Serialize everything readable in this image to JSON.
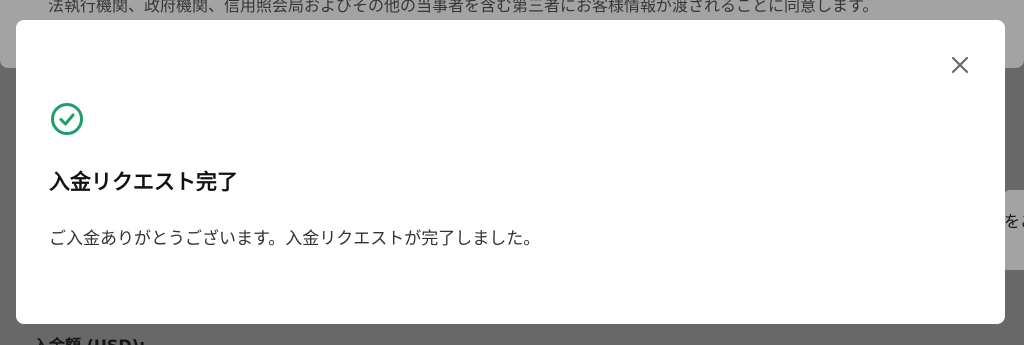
{
  "background": {
    "top_text": "法執行機関、政府機関、信用照会局およびその他の当事者を含む第三者にお客様情報が渡されることに同意します。",
    "right_text": "をご",
    "bottom_label": "入金額 (USD):"
  },
  "modal": {
    "title": "入金リクエスト完了",
    "message": "ご入金ありがとうございます。入金リクエストが完了しました。",
    "icon": "check-circle-icon",
    "close_icon": "close-icon",
    "accent_color": "#1e9e6a"
  }
}
